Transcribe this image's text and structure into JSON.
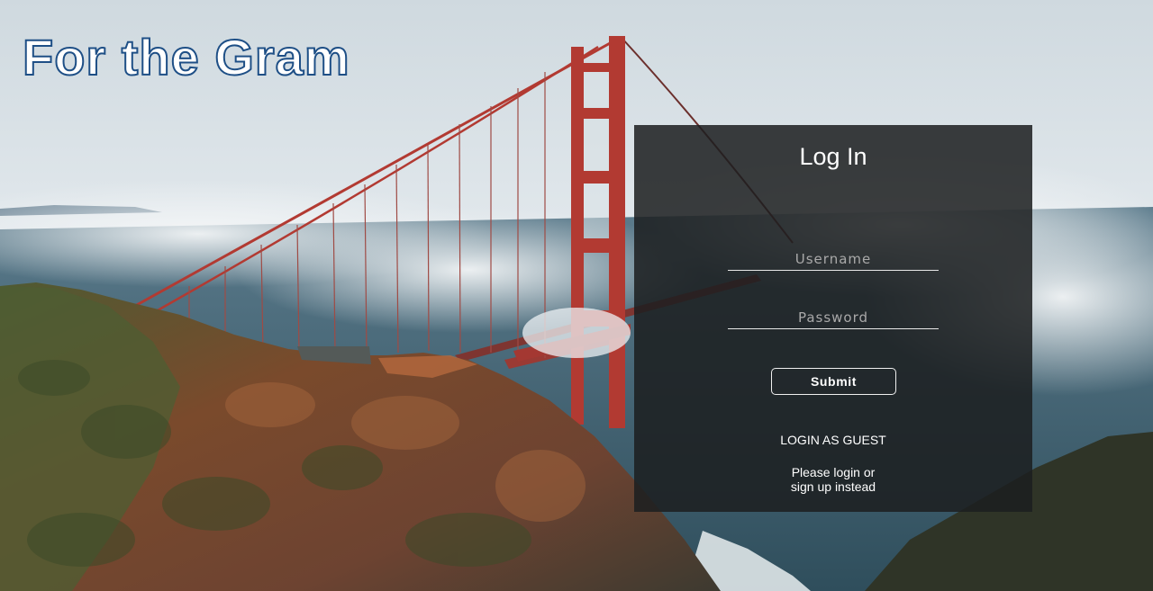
{
  "app": {
    "title": "For the Gram"
  },
  "login_panel": {
    "title": "Log In",
    "username_placeholder": "Username",
    "username_value": "",
    "password_placeholder": "Password",
    "password_value": "",
    "submit_label": "Submit",
    "guest_label": "LOGIN AS GUEST",
    "note_line1": "Please login or",
    "note_line2": "sign up instead"
  },
  "colors": {
    "brand_outline": "#1e4f86",
    "panel_background": "#1c1e1f",
    "bridge_red": "#b23a32"
  }
}
